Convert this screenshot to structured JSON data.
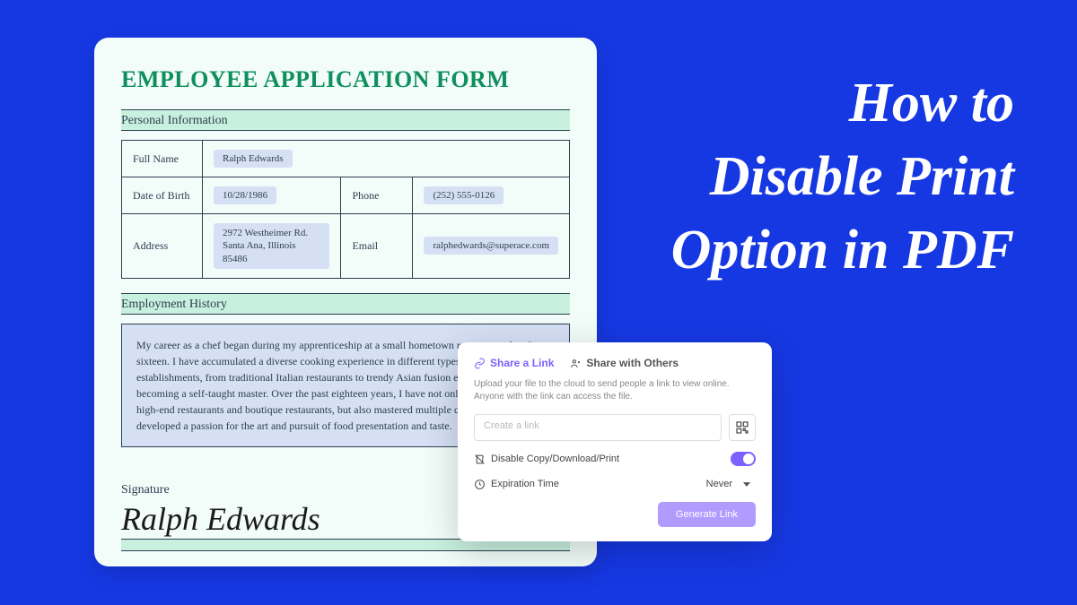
{
  "headline": "How to Disable Print Option in PDF",
  "form": {
    "title": "EMPLOYEE APPLICATION FORM",
    "sections": {
      "personal": {
        "header": "Personal Information",
        "fields": {
          "fullname_label": "Full Name",
          "fullname_value": "Ralph Edwards",
          "dob_label": "Date of Birth",
          "dob_value": "10/28/1986",
          "phone_label": "Phone",
          "phone_value": "(252) 555-0126",
          "address_label": "Address",
          "address_value_line1": "2972 Westheimer Rd.",
          "address_value_line2": "Santa Ana, Illinois 85486",
          "email_label": "Email",
          "email_value": "ralphedwards@superace.com"
        }
      },
      "history": {
        "header": "Employment History",
        "text": "My career as a chef began during my apprenticeship at a small hometown restaurant when I was sixteen. I have accumulated a diverse cooking experience in different types of dining establishments, from traditional Italian restaurants to trendy Asian fusion eateries, after becoming a self-taught master. Over the past eighteen years, I have not only served dishes in high-end restaurants and boutique restaurants, but also mastered multiple cooking skills and developed a passion for the art and pursuit of food presentation and taste."
      },
      "signature": {
        "label": "Signature",
        "value": "Ralph Edwards"
      }
    }
  },
  "share": {
    "tab_link": "Share a Link",
    "tab_others": "Share with Others",
    "description": "Upload your file to the cloud to send people a link to view online. Anyone with the link can access the file.",
    "link_placeholder": "Create a link",
    "disable_label": "Disable Copy/Download/Print",
    "expiration_label": "Expiration Time",
    "expiration_value": "Never",
    "generate_button": "Generate Link"
  }
}
